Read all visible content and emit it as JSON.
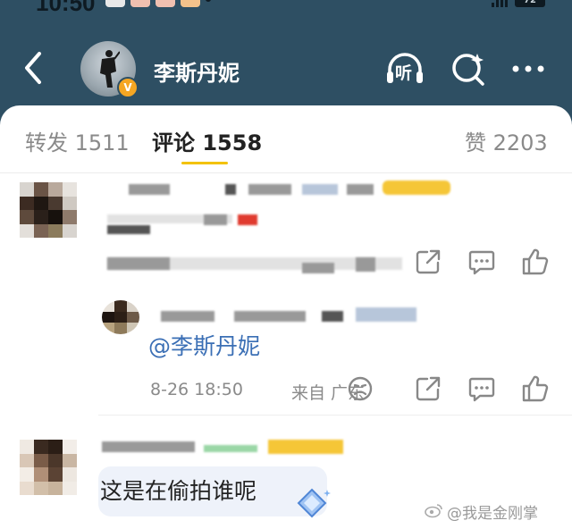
{
  "statusbar": {
    "time": "10:50",
    "battery": "72"
  },
  "header": {
    "back_icon": "chevron-left-icon",
    "profile_name": "李斯丹妮",
    "vip_badge": "V",
    "listen_icon": "headphone-listen-icon",
    "listen_label": "听",
    "search_icon": "search-sparkle-icon",
    "more_icon": "more-dots-icon"
  },
  "tabs": [
    {
      "label": "转发 1511",
      "active": false
    },
    {
      "label": "评论 1558",
      "active": true
    },
    {
      "label": "赞 2203",
      "active": false
    }
  ],
  "comments": {
    "reply": {
      "mention": "@李斯丹妮",
      "timestamp": "8-26 18:50",
      "location": "来自 广东"
    },
    "second": {
      "text": "这是在偷拍谁呢"
    }
  },
  "watermark": "@我是金刚掌",
  "colors": {
    "header_bg": "#2e4f63",
    "mention_blue": "#3b6fb5",
    "tab_underline": "#f3c200",
    "vip_orange": "#f5a623"
  }
}
